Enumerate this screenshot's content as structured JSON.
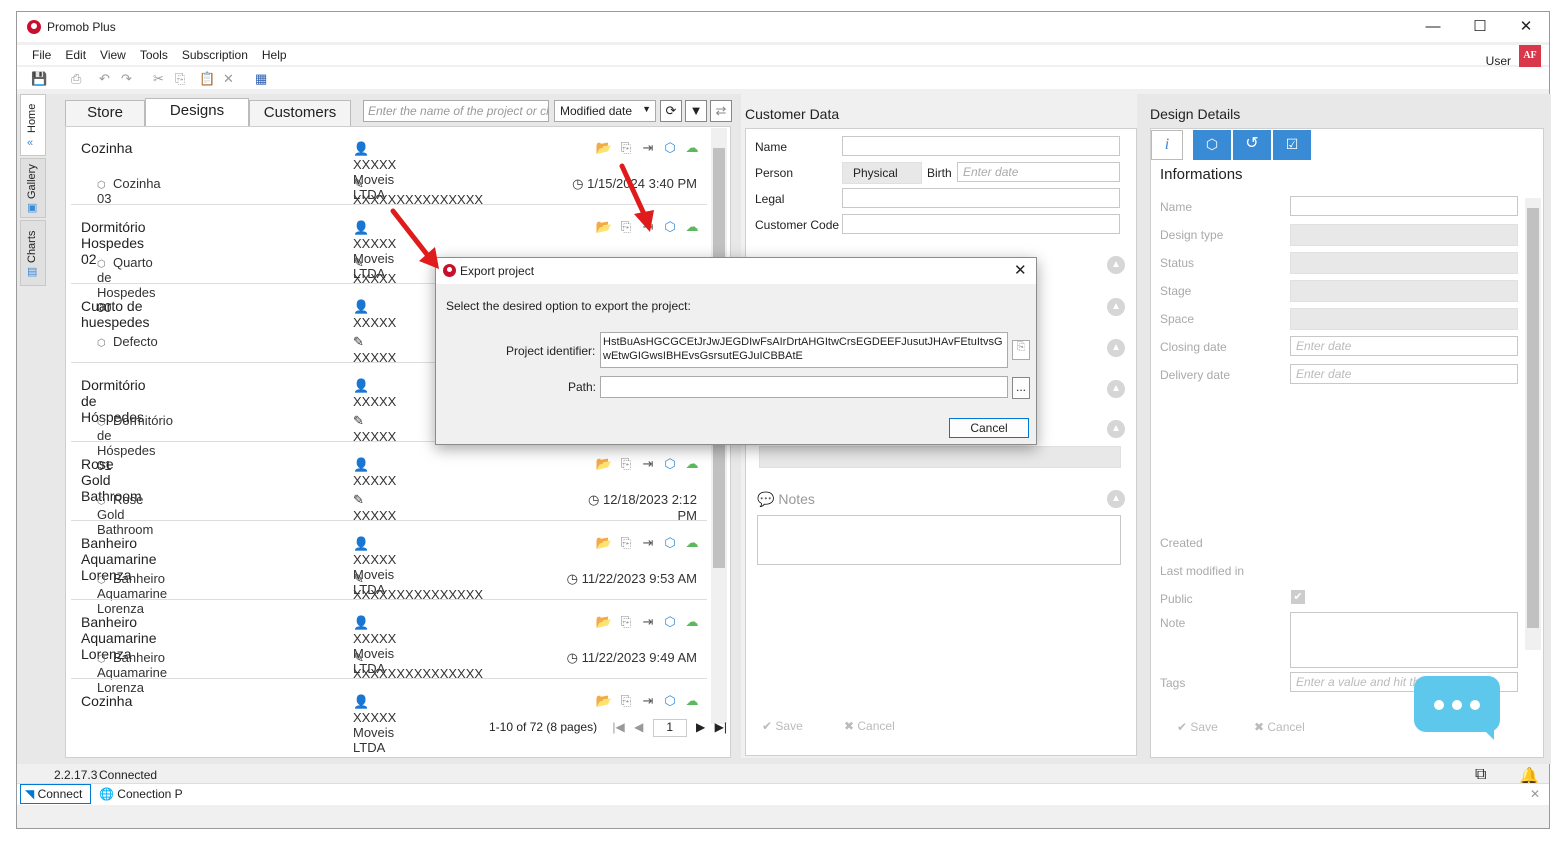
{
  "window": {
    "title": "Promob Plus",
    "min": "—",
    "max": "☐",
    "close": "✕"
  },
  "menu": [
    "File",
    "Edit",
    "View",
    "Tools",
    "Subscription",
    "Help"
  ],
  "user": {
    "label": "User",
    "initials": "AF"
  },
  "vtabs": [
    "Home",
    "Gallery",
    "Charts"
  ],
  "tabs": [
    "Store",
    "Designs",
    "Customers"
  ],
  "search": {
    "placeholder": "Enter the name of the project or cli"
  },
  "sort": {
    "value": "Modified date"
  },
  "projects": [
    {
      "name": "Cozinha",
      "owner": "XXXXX Moveis LTDA",
      "design": "Cozinha 03",
      "designer": "XXXXXXXXXXXXXXX",
      "date": "1/15/2024 3:40 PM"
    },
    {
      "name": "Dormitório Hospedes 02",
      "owner": "XXXXX Moveis LTDA",
      "design": "Quarto de Hospedes 00",
      "designer": "XXXXX",
      "date": ""
    },
    {
      "name": "Cuarto de huespedes",
      "owner": "XXXXX",
      "design": "Defecto",
      "designer": "XXXXX",
      "date": ""
    },
    {
      "name": "Dormitório de Hóspedes",
      "owner": "XXXXX",
      "design": "Dormitório de Hóspedes 01",
      "designer": "XXXXX",
      "date": ""
    },
    {
      "name": "Rose Gold Bathroom",
      "owner": "XXXXX",
      "design": "Rose Gold Bathroom",
      "designer": "XXXXX",
      "date": "12/18/2023 2:12 PM"
    },
    {
      "name": "Banheiro Aquamarine Lorenza",
      "owner": "XXXXX Moveis LTDA",
      "design": "Banheiro Aquamarine Lorenza",
      "designer": "XXXXXXXXXXXXXXX",
      "date": "11/22/2023 9:53 AM"
    },
    {
      "name": "Banheiro Aquamarine Lorenza",
      "owner": "XXXXX Moveis LTDA",
      "design": "Banheiro Aquamarine Lorenza",
      "designer": "XXXXXXXXXXXXXXX",
      "date": "11/22/2023 9:49 AM"
    },
    {
      "name": "Cozinha",
      "owner": "XXXXX Moveis LTDA",
      "design": "",
      "designer": "",
      "date": ""
    }
  ],
  "pager": {
    "summary": "1-10 of 72 (8 pages)",
    "page": "1"
  },
  "customer": {
    "title": "Customer Data",
    "name_label": "Name",
    "person_label": "Person",
    "person_value": "Physical",
    "birth_label": "Birth",
    "birth_placeholder": "Enter date",
    "legal_label": "Legal",
    "code_label": "Customer Code",
    "notes_label": "Notes",
    "save": "Save",
    "cancel": "Cancel"
  },
  "design_details": {
    "title": "Design Details",
    "section": "Informations",
    "labels": [
      "Name",
      "Design type",
      "Status",
      "Stage",
      "Space",
      "Closing date",
      "Delivery date"
    ],
    "date_placeholder": "Enter date",
    "created": "Created",
    "last_modified": "Last modified in",
    "public": "Public",
    "note": "Note",
    "tags": "Tags",
    "tags_placeholder": "Enter a value and hit the enter key",
    "save": "Save",
    "cancel": "Cancel"
  },
  "dialog": {
    "title": "Export project",
    "prompt": "Select the desired option to export the project:",
    "identifier_label": "Project identifier:",
    "identifier_value": "HstBuAsHGCGCEtJrJwJEGDIwFsAIrDrtAHGItwCrsEGDEEFJusutJHAvFEtuItvsGwEtwGIGwsIBHEvsGsrsutEGJuICBBAtE",
    "path_label": "Path:",
    "browse": "...",
    "cancel": "Cancel"
  },
  "status": {
    "version": "2.2.17.3",
    "state": "Connected"
  },
  "bottom": {
    "connect": "Connect",
    "connection": "Conection P"
  },
  "colors": {
    "accent": "#0078d4",
    "brand": "#c8102e",
    "chat": "#5ec8ec",
    "arrow": "#e01b1b"
  }
}
